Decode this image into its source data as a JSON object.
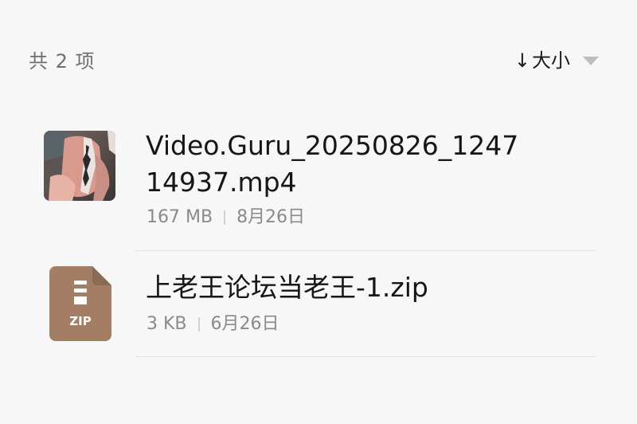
{
  "header": {
    "item_count": "共 2 项",
    "sort_arrow": "↓",
    "sort_label": "大小",
    "sort_dropdown_icon": "caret-down-icon"
  },
  "files": [
    {
      "name": "Video.Guru_20250826_124714937.mp4",
      "size": "167 MB",
      "date": "8月26日",
      "icon": "video-thumbnail"
    },
    {
      "name": "上老王论坛当老王-1.zip",
      "size": "3 KB",
      "date": "6月26日",
      "icon": "zip-file-icon",
      "icon_label": "ZIP"
    }
  ],
  "colors": {
    "background": "#f7f7f7",
    "zip_icon": "#a47e64",
    "secondary_text": "#8a8a8a",
    "divider": "#e2e2e2"
  }
}
